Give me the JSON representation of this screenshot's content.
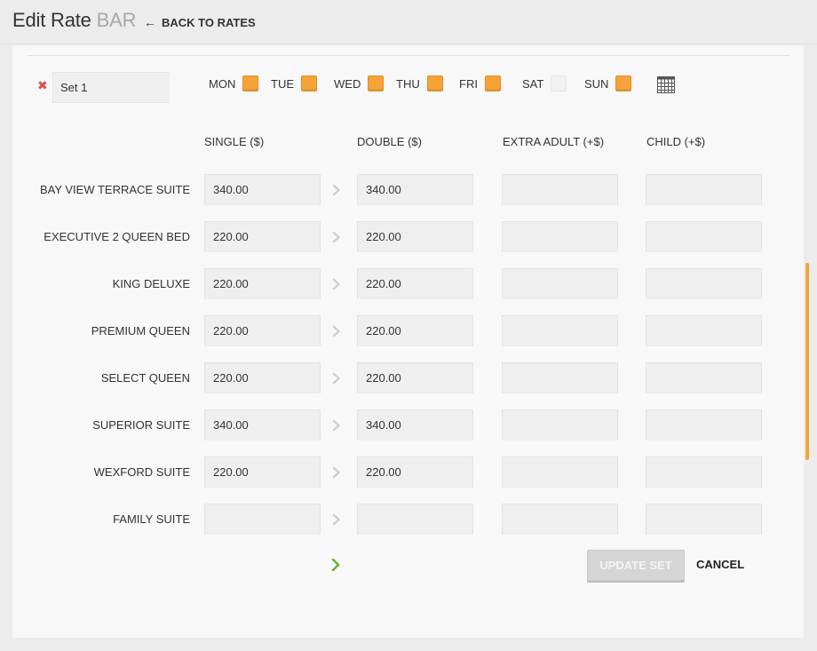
{
  "header": {
    "title": "Edit Rate",
    "rate_name": "BAR",
    "back_label": "BACK TO RATES"
  },
  "set": {
    "name_value": "Set 1"
  },
  "days": [
    {
      "label": "MON",
      "checked": true
    },
    {
      "label": "TUE",
      "checked": true
    },
    {
      "label": "WED",
      "checked": true
    },
    {
      "label": "THU",
      "checked": true
    },
    {
      "label": "FRI",
      "checked": true
    },
    {
      "label": "SAT",
      "checked": false
    },
    {
      "label": "SUN",
      "checked": true
    }
  ],
  "columns": {
    "single": "SINGLE ($)",
    "double": "DOUBLE ($)",
    "extra_adult": "EXTRA ADULT (+$)",
    "child": "CHILD (+$)"
  },
  "rows": [
    {
      "label": "BAY VIEW TERRACE SUITE",
      "single": "340.00",
      "double": "340.00",
      "extra_adult": "",
      "child": ""
    },
    {
      "label": "EXECUTIVE 2 QUEEN BED",
      "single": "220.00",
      "double": "220.00",
      "extra_adult": "",
      "child": ""
    },
    {
      "label": "KING DELUXE",
      "single": "220.00",
      "double": "220.00",
      "extra_adult": "",
      "child": ""
    },
    {
      "label": "PREMIUM QUEEN",
      "single": "220.00",
      "double": "220.00",
      "extra_adult": "",
      "child": ""
    },
    {
      "label": "SELECT QUEEN",
      "single": "220.00",
      "double": "220.00",
      "extra_adult": "",
      "child": ""
    },
    {
      "label": "SUPERIOR SUITE",
      "single": "340.00",
      "double": "340.00",
      "extra_adult": "",
      "child": ""
    },
    {
      "label": "WEXFORD SUITE",
      "single": "220.00",
      "double": "220.00",
      "extra_adult": "",
      "child": ""
    },
    {
      "label": "FAMILY SUITE",
      "single": "",
      "double": "",
      "extra_adult": "",
      "child": ""
    }
  ],
  "actions": {
    "update_label": "UPDATE SET",
    "cancel_label": "CANCEL"
  },
  "colors": {
    "accent": "#f6a33a",
    "remove": "#d9534f",
    "copy_all": "#6fae3c"
  }
}
